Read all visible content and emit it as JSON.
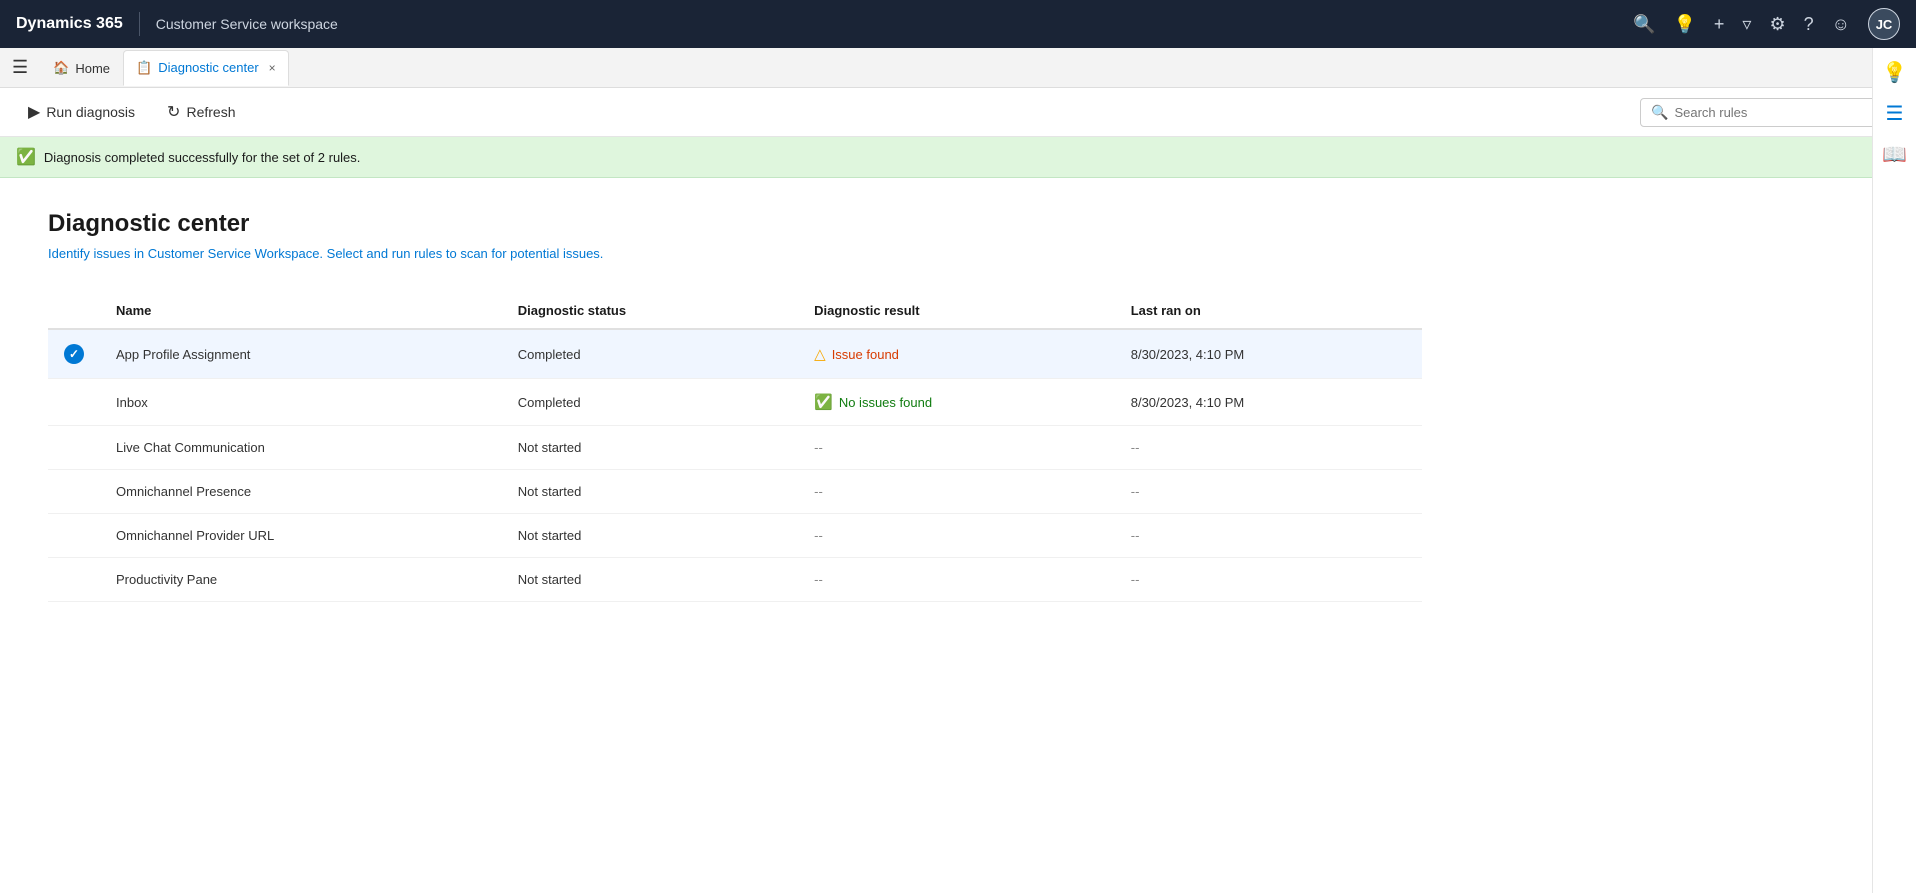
{
  "topbar": {
    "brand": "Dynamics 365",
    "app": "Customer Service workspace",
    "icons": [
      "search",
      "lightbulb",
      "plus",
      "filter",
      "settings",
      "help",
      "smiley"
    ],
    "avatar": "JC"
  },
  "tabs": {
    "home_label": "Home",
    "active_label": "Diagnostic center",
    "close_label": "×"
  },
  "toolbar": {
    "run_diagnosis_label": "Run diagnosis",
    "refresh_label": "Refresh",
    "search_placeholder": "Search rules"
  },
  "banner": {
    "message": "Diagnosis completed successfully for the set of 2 rules.",
    "close_label": "×"
  },
  "page": {
    "title": "Diagnostic center",
    "subtitle": "Identify issues in Customer Service Workspace. Select and run rules to scan for potential issues."
  },
  "table": {
    "headers": [
      "Name",
      "Diagnostic status",
      "Diagnostic result",
      "Last ran on"
    ],
    "rows": [
      {
        "name": "App Profile Assignment",
        "status": "Completed",
        "result_type": "issue",
        "result_label": "Issue found",
        "last_ran": "8/30/2023, 4:10 PM",
        "selected": true
      },
      {
        "name": "Inbox",
        "status": "Completed",
        "result_type": "ok",
        "result_label": "No issues found",
        "last_ran": "8/30/2023, 4:10 PM",
        "selected": false
      },
      {
        "name": "Live Chat Communication",
        "status": "Not started",
        "result_type": "na",
        "result_label": "--",
        "last_ran": "--",
        "selected": false
      },
      {
        "name": "Omnichannel Presence",
        "status": "Not started",
        "result_type": "na",
        "result_label": "--",
        "last_ran": "--",
        "selected": false
      },
      {
        "name": "Omnichannel Provider URL",
        "status": "Not started",
        "result_type": "na",
        "result_label": "--",
        "last_ran": "--",
        "selected": false
      },
      {
        "name": "Productivity Pane",
        "status": "Not started",
        "result_type": "na",
        "result_label": "--",
        "last_ran": "--",
        "selected": false
      }
    ]
  },
  "right_sidebar": {
    "icons": [
      "lightbulb",
      "list",
      "book"
    ]
  }
}
